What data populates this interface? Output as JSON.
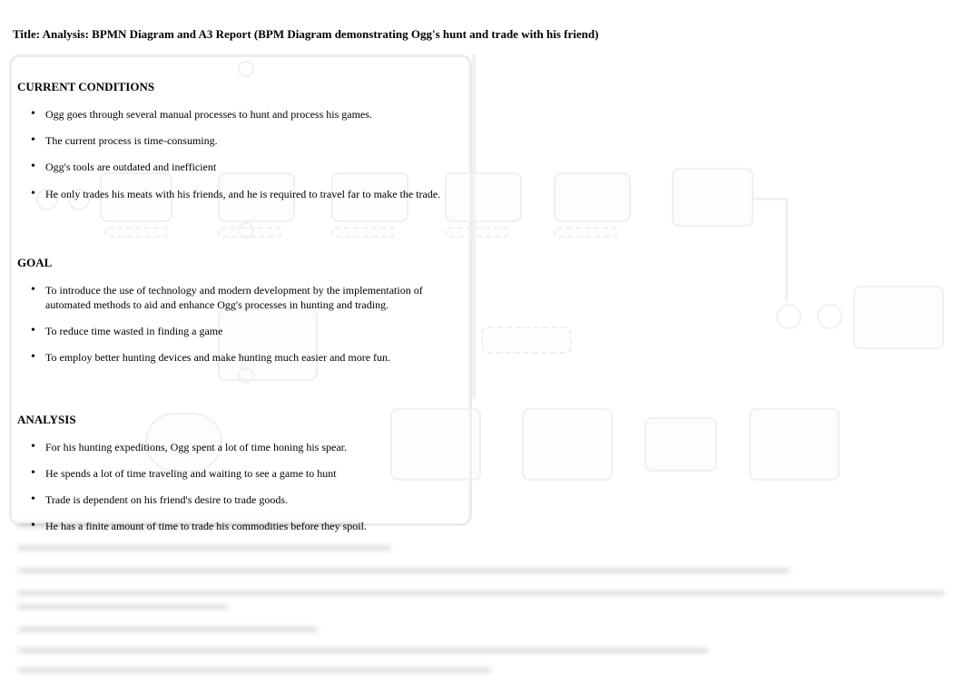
{
  "title": "Title: Analysis: BPMN Diagram and A3 Report (BPM Diagram demonstrating Ogg's hunt and trade with his friend)",
  "sections": {
    "current_conditions": {
      "heading": "CURRENT CONDITIONS",
      "items": [
        "Ogg goes through several manual processes to hunt and process his games.",
        "The current process is time-consuming.",
        "Ogg's tools are outdated and inefficient",
        "He only trades his meats with his friends, and he is required to travel far to make the trade."
      ]
    },
    "goal": {
      "heading": "GOAL",
      "items": [
        "To introduce the use of technology and modern development by the implementation of automated methods to aid and enhance Ogg's processes in hunting and trading.",
        "To reduce time wasted in finding a game",
        "To employ better hunting devices and make hunting much easier and more fun."
      ]
    },
    "analysis": {
      "heading": "ANALYSIS",
      "items": [
        "For his hunting expeditions, Ogg spent a lot of time honing his spear.",
        "He spends a lot of time traveling and waiting to see a game to hunt",
        "Trade is dependent on his friend's desire to trade goods.",
        "He has a finite amount of time to trade his commodities before they spoil."
      ]
    }
  }
}
